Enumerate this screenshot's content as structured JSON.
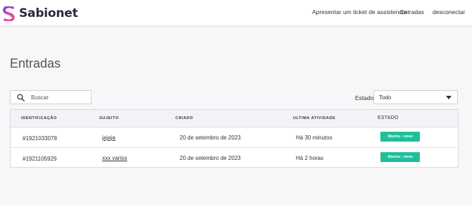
{
  "header": {
    "brand": "Sabionet",
    "nav": {
      "submit_ticket": "Apresentar um ticket de assistencia",
      "entries": "Entradas",
      "logout": "desconectar"
    }
  },
  "page": {
    "title": "Entradas"
  },
  "filters": {
    "search_placeholder": "Buscar",
    "state_label": "Estado",
    "state_value": "Todo"
  },
  "table": {
    "columns": {
      "id": "IDENTIFICAÇÃO",
      "subject": "SUJEITO",
      "created": "CRIADO",
      "last_activity": "ULTIMA ATIVIDADE",
      "state": "ESTADO"
    },
    "rows": [
      {
        "id": "#1921033078",
        "subject": "jajaja",
        "created": "20 de setembro de 2023",
        "last_activity": "Há 30 minutos",
        "state": "Aberto - novo"
      },
      {
        "id": "#1921105929",
        "subject": "xxx varios",
        "created": "20 de setembro de 2023",
        "last_activity": "Há 2 horas",
        "state": "Aberto - novo"
      }
    ]
  },
  "colors": {
    "accent_purple": "#7b3fe4",
    "accent_pink": "#e94b9a",
    "status_open": "#1fbf9a",
    "brand_text": "#2a2a3c"
  },
  "icons": {
    "logo": "sabionet-logo-icon",
    "search": "search-icon",
    "dropdown": "chevron-down-icon"
  }
}
